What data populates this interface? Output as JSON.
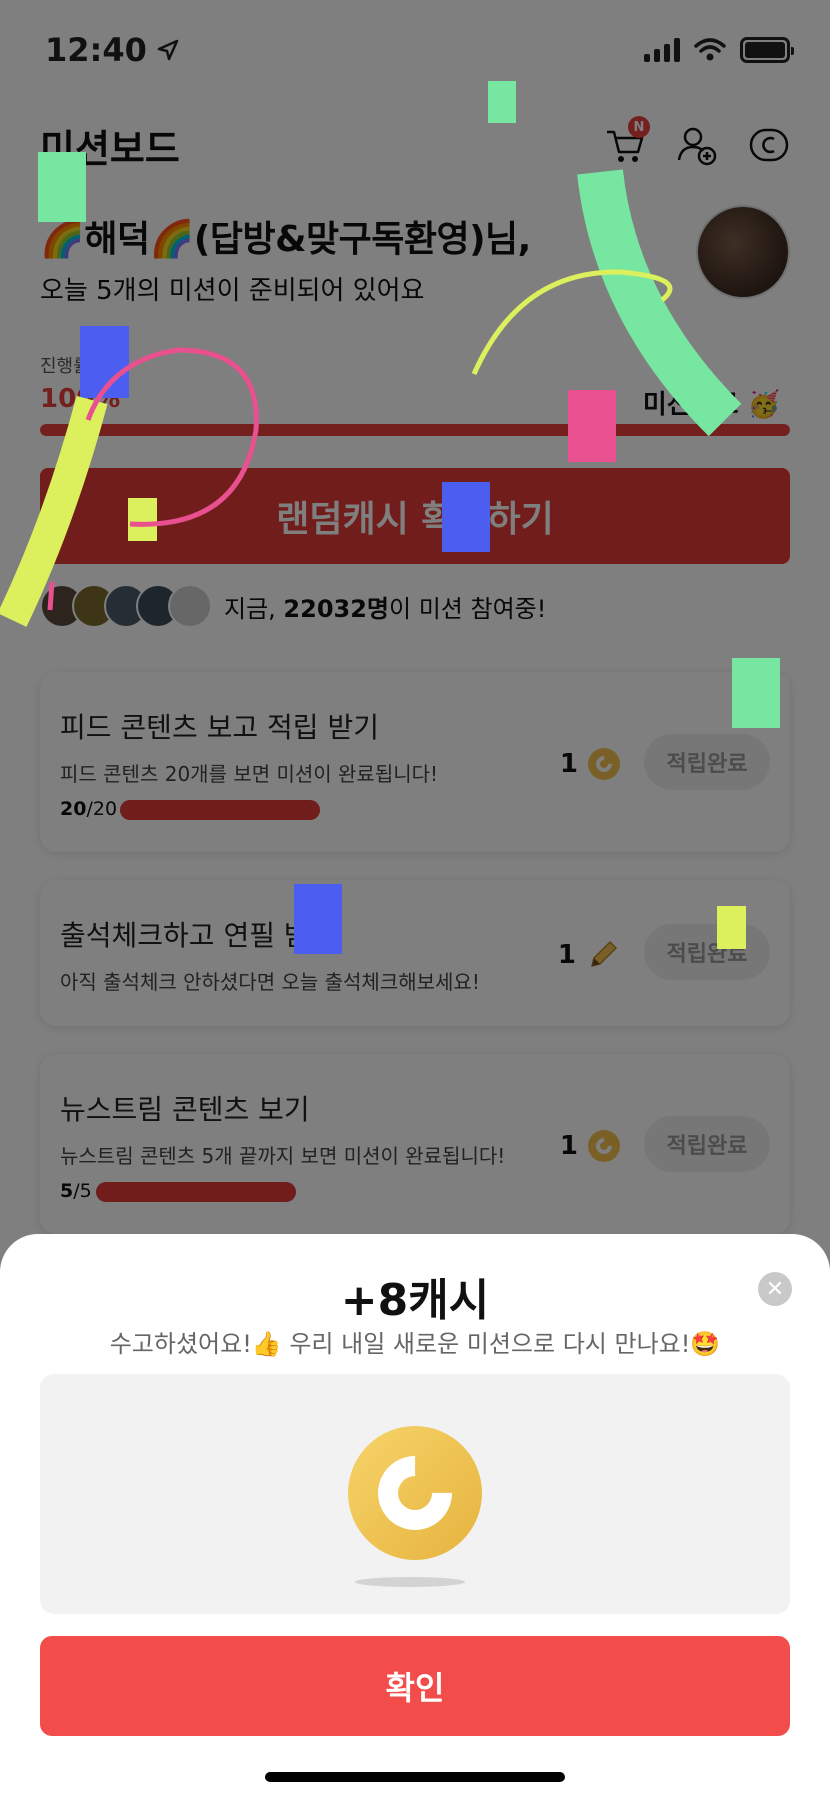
{
  "status": {
    "time": "12:40"
  },
  "header": {
    "title": "미션보드",
    "cart_badge": "N"
  },
  "greeting": {
    "name": "🌈해덕🌈(답방&맞구독환영)님,",
    "subtitle": "오늘 5개의 미션이 준비되어 있어요"
  },
  "progress": {
    "label": "진행률",
    "percent_text": "100%",
    "done_text": "미션완료 🥳",
    "value": 1.0
  },
  "random_button": {
    "label": "랜덤캐시 확인하기"
  },
  "participants": {
    "prefix": "지금, ",
    "count": "22032명",
    "suffix": "이 미션 참여중!"
  },
  "missions": [
    {
      "title": "피드 콘텐츠 보고 적립 받기",
      "desc": "피드 콘텐츠 20개를 보면 미션이 완료됩니다!",
      "done": "20",
      "total": "/20",
      "reward": "1",
      "reward_icon": "coin-icon",
      "status": "적립완료"
    },
    {
      "title": "출석체크하고 연필 받기",
      "desc": "아직 출석체크 안하셨다면 오늘 출석체크해보세요!",
      "reward": "1",
      "reward_icon": "pencil-icon",
      "status": "적립완료"
    },
    {
      "title": "뉴스트림 콘텐츠 보기",
      "desc": "뉴스트림 콘텐츠 5개 끝까지 보면 미션이 완료됩니다!",
      "done": "5",
      "total": "/5",
      "reward": "1",
      "reward_icon": "coin-icon",
      "status": "적립완료"
    }
  ],
  "sheet": {
    "amount": "+8캐시",
    "message": "수고하셨어요!👍 우리 내일 새로운 미션으로 다시 만나요!🤩",
    "confirm": "확인"
  },
  "colors": {
    "accent": "#e33a37",
    "confirm": "#f24d4a",
    "coin": "#f2c14e"
  }
}
